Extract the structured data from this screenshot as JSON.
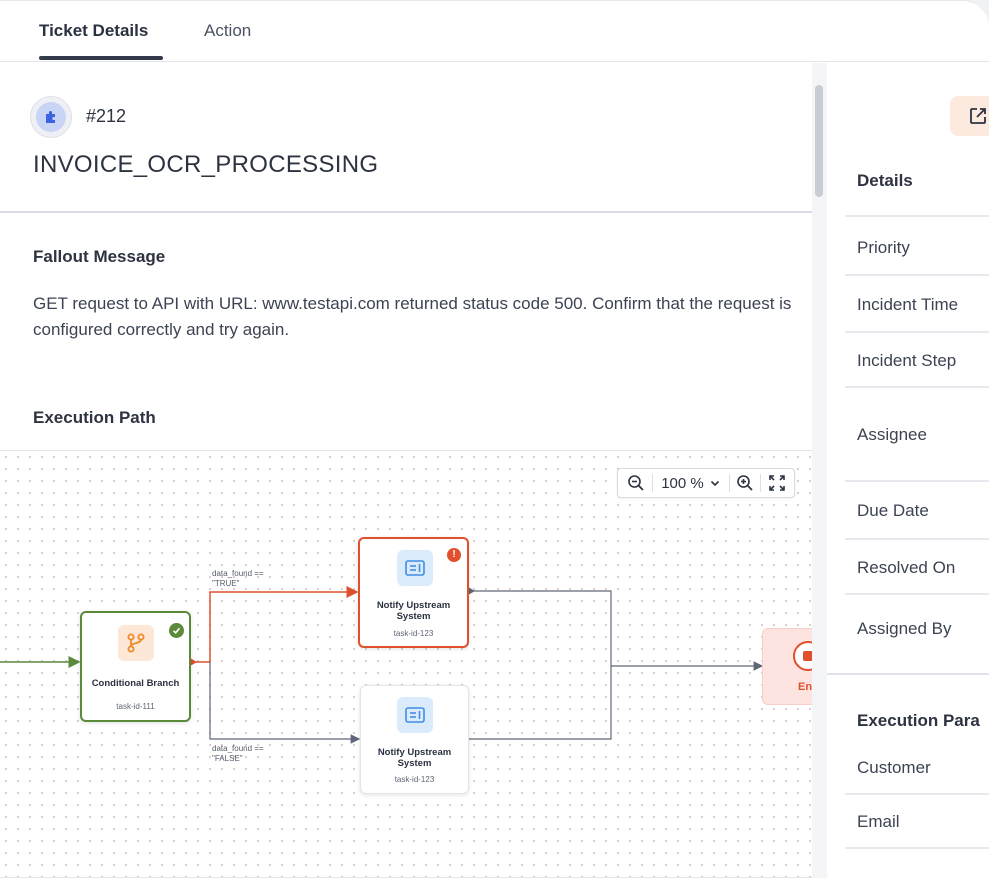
{
  "tabs": [
    {
      "label": "Ticket Details",
      "active": true
    },
    {
      "label": "Action",
      "active": false
    }
  ],
  "ticket": {
    "id": "#212",
    "title": "INVOICE_OCR_PROCESSING",
    "icon": "puzzle-icon"
  },
  "fallout": {
    "heading": "Fallout Message",
    "message": "GET request to API with URL: www.testapi.com returned status code 500. Confirm that the request is configured correctly and try again."
  },
  "execution": {
    "heading": "Execution Path",
    "zoom": "100 %",
    "nodes": {
      "branch": {
        "name": "Conditional Branch",
        "task_id": "task-id-111",
        "status": "success"
      },
      "notify_true": {
        "name": "Notify Upstream System",
        "task_id": "task-id-123",
        "status": "error"
      },
      "notify_false": {
        "name": "Notify Upstream System",
        "task_id": "task-id-123",
        "status": "idle"
      },
      "end": {
        "name": "En",
        "status": "end"
      }
    },
    "edges": {
      "true_label": "data_found ==\n\"TRUE\"",
      "false_label": "data_found ==\n\"FALSE\""
    },
    "colors": {
      "success": "#5a8a3a",
      "error": "#e0502c",
      "neutral": "#5e6677",
      "accent_orange": "#f08a2c",
      "accent_blue": "#3e8ee6"
    }
  },
  "details": {
    "heading": "Details",
    "fields": [
      "Priority",
      "Incident Time",
      "Incident Step",
      "Assignee",
      "Due Date",
      "Resolved On",
      "Assigned By"
    ]
  },
  "execution_params": {
    "heading": "Execution Para",
    "fields": [
      "Customer",
      "Email"
    ]
  }
}
